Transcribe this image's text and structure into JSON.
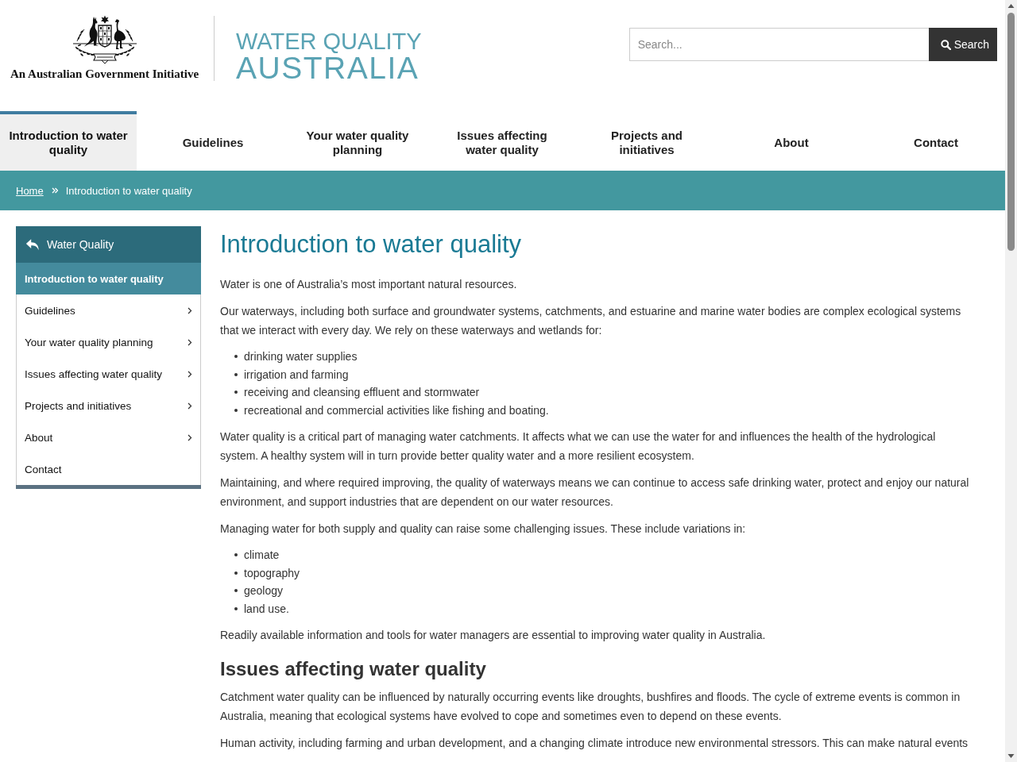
{
  "header": {
    "logo_caption": "An Australian Government Initiative",
    "site_title": [
      "WATER QUALITY",
      "AUSTRALIA"
    ],
    "search": {
      "placeholder": "Search...",
      "button": "Search"
    }
  },
  "nav": [
    {
      "label": "Introduction to water quality",
      "selected": true
    },
    {
      "label": "Guidelines",
      "selected": false
    },
    {
      "label": "Your water quality planning",
      "selected": false
    },
    {
      "label": "Issues affecting water quality",
      "selected": false
    },
    {
      "label": "Projects and initiatives",
      "selected": false
    },
    {
      "label": "About",
      "selected": false
    },
    {
      "label": "Contact",
      "selected": false
    }
  ],
  "breadcrumb": [
    {
      "label": "Home",
      "kind": "link"
    },
    {
      "label": "Introduction to water quality",
      "kind": "current"
    }
  ],
  "sidebar": {
    "title": "Water Quality",
    "items": [
      {
        "label": "Introduction to water quality",
        "selected": true,
        "expandable": false
      },
      {
        "label": "Guidelines",
        "selected": false,
        "expandable": true
      },
      {
        "label": "Your water quality planning",
        "selected": false,
        "expandable": true
      },
      {
        "label": "Issues affecting water quality",
        "selected": false,
        "expandable": true
      },
      {
        "label": "Projects and initiatives",
        "selected": false,
        "expandable": true
      },
      {
        "label": "About",
        "selected": false,
        "expandable": true
      },
      {
        "label": "Contact",
        "selected": false,
        "expandable": false
      }
    ]
  },
  "content": {
    "title": "Introduction to water quality",
    "blocks": [
      {
        "kind": "paragraph",
        "text": "Water is one of Australia’s most important natural resources."
      },
      {
        "kind": "paragraph",
        "text": "Our waterways, including both surface and groundwater systems, catchments, and estuarine and marine water bodies are complex ecological systems that we interact with every day. We rely on these waterways and wetlands for:"
      },
      {
        "kind": "list",
        "items": [
          "drinking water supplies",
          "irrigation and farming",
          "receiving and cleansing effluent and stormwater",
          "recreational and commercial activities like fishing and boating."
        ]
      },
      {
        "kind": "paragraph",
        "text": "Water quality is a critical part of managing water catchments. It affects what we can use the water for and influences the health of the hydrological system. A healthy system will in turn provide better quality water and a more resilient ecosystem."
      },
      {
        "kind": "paragraph",
        "text": "Maintaining, and where required improving, the quality of waterways means we can continue to access safe drinking water, protect and enjoy our natural environment, and support industries that are dependent on our water resources."
      },
      {
        "kind": "paragraph",
        "text": "Managing water for both supply and quality can raise some challenging issues. These include variations in:"
      },
      {
        "kind": "list",
        "items": [
          "climate",
          "topography",
          "geology",
          "land use."
        ]
      },
      {
        "kind": "paragraph",
        "text": "Readily available information and tools for water managers are essential to improving water quality in Australia."
      },
      {
        "kind": "heading",
        "text": "Issues affecting water quality"
      },
      {
        "kind": "paragraph",
        "text": "Catchment water quality can be influenced by naturally occurring events like droughts, bushfires and floods. The cycle of extreme events is common in Australia, meaning that ecological systems have evolved to cope and sometimes even to depend on these events."
      },
      {
        "kind": "paragraph",
        "text": "Human activity, including farming and urban development, and a changing climate introduce new environmental stressors. This can make natural events"
      }
    ]
  }
}
